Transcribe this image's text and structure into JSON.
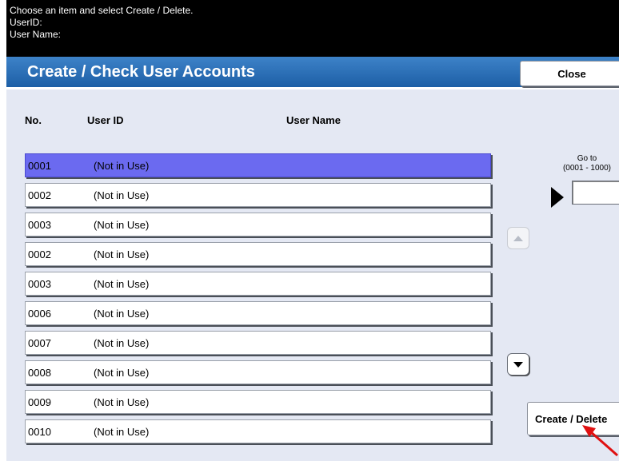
{
  "status": {
    "instruction": "Choose an item and select Create / Delete.",
    "user_id_label": "UserID:",
    "user_name_label": "User Name:"
  },
  "title": "Create / Check User Accounts",
  "close_label": "Close",
  "columns": {
    "no": "No.",
    "user_id": "User ID",
    "user_name": "User Name"
  },
  "rows": [
    {
      "no": "0001",
      "user_id": "(Not in Use)",
      "selected": true
    },
    {
      "no": "0002",
      "user_id": "(Not in Use)",
      "selected": false
    },
    {
      "no": "0003",
      "user_id": "(Not in Use)",
      "selected": false
    },
    {
      "no": "0002",
      "user_id": "(Not in Use)",
      "selected": false
    },
    {
      "no": "0003",
      "user_id": "(Not in Use)",
      "selected": false
    },
    {
      "no": "0006",
      "user_id": "(Not in Use)",
      "selected": false
    },
    {
      "no": "0007",
      "user_id": "(Not in Use)",
      "selected": false
    },
    {
      "no": "0008",
      "user_id": "(Not in Use)",
      "selected": false
    },
    {
      "no": "0009",
      "user_id": "(Not in Use)",
      "selected": false
    },
    {
      "no": "0010",
      "user_id": "(Not in Use)",
      "selected": false
    }
  ],
  "goto": {
    "label": "Go to",
    "range": "(0001 - 1000)",
    "value": ""
  },
  "create_delete_label": "Create / Delete",
  "colors": {
    "title_bar": "#1d5fa6",
    "selected_row": "#6b6af0",
    "background": "#e4e8f3",
    "annotation_arrow": "#e01010"
  }
}
